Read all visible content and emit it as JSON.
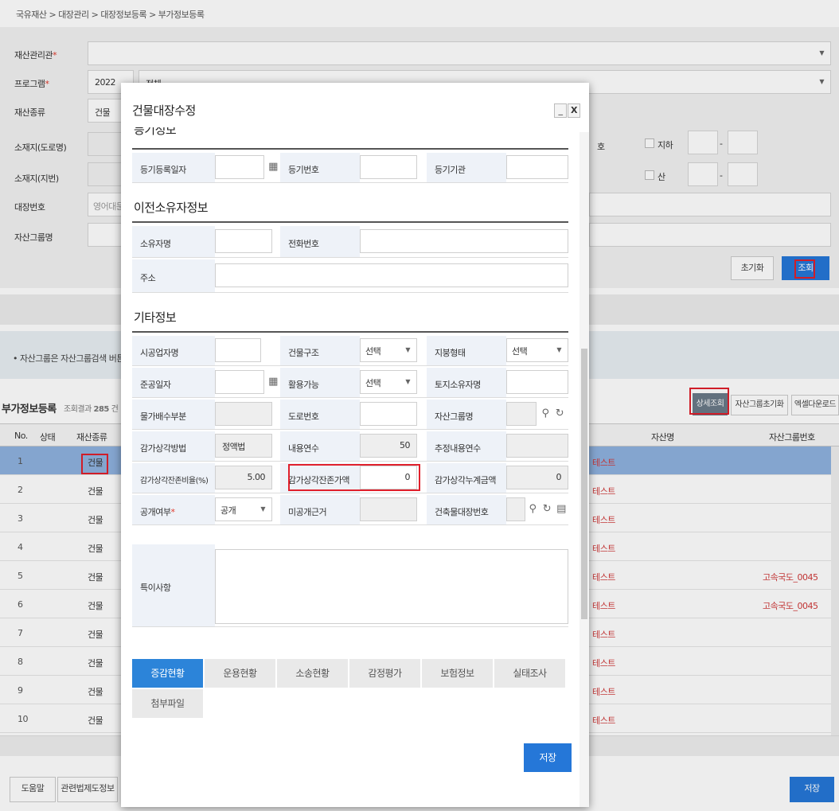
{
  "breadcrumb": "국유재산 > 대장관리 > 대장정보등록 > 부가정보등록",
  "search": {
    "labels": {
      "manager": "재산관리관",
      "program": "프로그램",
      "asset_type": "재산종류",
      "address_road": "소재지(도로명)",
      "address_lot": "소재지(지번)",
      "ledger_no": "대장번호",
      "group_name": "자산그룹명"
    },
    "required_mark": "*",
    "program_year": "2022",
    "program_value": "전체",
    "asset_type_value": "건물",
    "ledger_placeholder": "영어대문",
    "ho_label": "호",
    "basement_label": "지하",
    "mountain_label": "산",
    "dash": "-",
    "reset_button": "초기화",
    "search_button": "조회"
  },
  "notice": "• 자산그룹은 자산그룹검색 버튼",
  "grid": {
    "title": "부가정보등록",
    "count_label": "조회결과",
    "count": "285",
    "count_unit": "건",
    "buttons": {
      "detail": "상세조회",
      "group_reset": "자산그룹초기화",
      "excel": "엑셀다운로드"
    },
    "headers": {
      "no": "No.",
      "state": "상태",
      "type": "재산종류",
      "name": "자산명",
      "group": "자산그룹번호"
    },
    "rows": [
      {
        "no": "1",
        "type": "건물",
        "name": "테스트",
        "group": ""
      },
      {
        "no": "2",
        "type": "건물",
        "name": "테스트",
        "group": ""
      },
      {
        "no": "3",
        "type": "건물",
        "name": "테스트",
        "group": ""
      },
      {
        "no": "4",
        "type": "건물",
        "name": "테스트",
        "group": ""
      },
      {
        "no": "5",
        "type": "건물",
        "name": "테스트",
        "group": "고속국도_0045"
      },
      {
        "no": "6",
        "type": "건물",
        "name": "테스트",
        "group": "고속국도_0045"
      },
      {
        "no": "7",
        "type": "건물",
        "name": "테스트",
        "group": ""
      },
      {
        "no": "8",
        "type": "건물",
        "name": "테스트",
        "group": ""
      },
      {
        "no": "9",
        "type": "건물",
        "name": "테스트",
        "group": ""
      },
      {
        "no": "10",
        "type": "건물",
        "name": "테스트",
        "group": ""
      }
    ]
  },
  "footer": {
    "help": "도움말",
    "law_info": "관련법제도정보",
    "save": "저장"
  },
  "modal": {
    "title": "건물대장수정",
    "minimize": "_",
    "close": "X",
    "sections": {
      "registry": "등기정보",
      "prev_owner": "이전소유자정보",
      "other": "기타정보"
    },
    "registry": {
      "date_label": "등기등록일자",
      "number_label": "등기번호",
      "office_label": "등기기관"
    },
    "prev_owner": {
      "owner_label": "소유자명",
      "phone_label": "전화번호",
      "address_label": "주소"
    },
    "other": {
      "contractor_label": "시공업자명",
      "structure_label": "건물구조",
      "structure_value": "선택",
      "roof_label": "지붕형태",
      "roof_value": "선택",
      "completion_label": "준공일자",
      "usable_label": "활용가능",
      "usable_value": "선택",
      "land_owner_label": "토지소유자명",
      "non_pay_label": "물가배수부분",
      "road_no_label": "도로번호",
      "group_name_label": "자산그룹명",
      "dep_method_label": "감가상각방법",
      "dep_method_value": "정액법",
      "life_label": "내용연수",
      "life_value": "50",
      "est_life_label": "추정내용연수",
      "residual_rate_label": "감가상각잔존비율(%)",
      "residual_rate_value": "5.00",
      "residual_value_label": "감가상각잔존가액",
      "residual_value_value": "0",
      "accum_label": "감가상각누계금액",
      "accum_value": "0",
      "public_label": "공개여부",
      "public_value": "공개",
      "nonpublic_label": "미공개근거",
      "ledger_no_label": "건축물대장번호",
      "remarks_label": "특이사항"
    },
    "tabs": [
      "증감현황",
      "운용현황",
      "소송현황",
      "감정평가",
      "보험정보",
      "실태조사",
      "첨부파일"
    ],
    "save": "저장"
  },
  "colors": {
    "accent": "#2577d8",
    "highlight": "#e0202c",
    "selected_row": "#8fb2df"
  }
}
